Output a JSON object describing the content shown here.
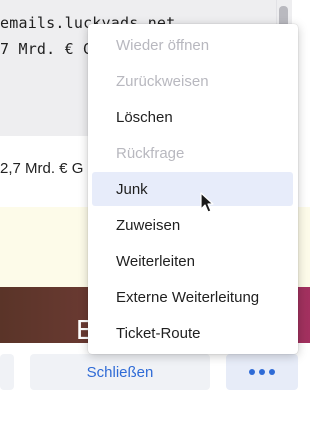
{
  "email_pane": {
    "code_lines": [
      "emails.luckyads.net",
      "7 Mrd. € G"
    ]
  },
  "preview": {
    "text": "2,7 Mrd. € G"
  },
  "photo": {
    "glyph": "E"
  },
  "menu": {
    "items": [
      {
        "label": "Wieder öffnen",
        "state": "disabled"
      },
      {
        "label": "Zurückweisen",
        "state": "disabled"
      },
      {
        "label": "Löschen",
        "state": "enabled"
      },
      {
        "label": "Rückfrage",
        "state": "disabled"
      },
      {
        "label": "Junk",
        "state": "highlighted"
      },
      {
        "label": "Zuweisen",
        "state": "enabled"
      },
      {
        "label": "Weiterleiten",
        "state": "enabled"
      },
      {
        "label": "Externe Weiterleitung",
        "state": "enabled"
      },
      {
        "label": "Ticket-Route",
        "state": "enabled"
      }
    ]
  },
  "actions": {
    "close_label": "Schließen",
    "more_icon": "ellipsis-icon"
  },
  "colors": {
    "accent": "#2f6bd6",
    "menu_highlight": "#e7ecfa",
    "disabled_text": "#b8b8bf"
  }
}
